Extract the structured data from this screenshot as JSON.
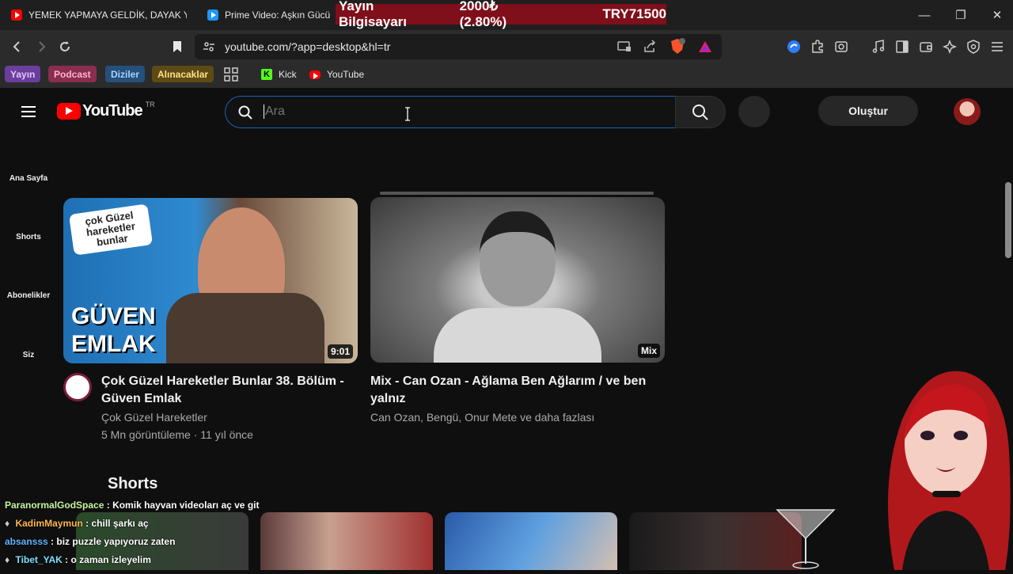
{
  "browser": {
    "tabs": [
      {
        "label": "YEMEK YAPMAYA GELDİK, DAYAK YE"
      },
      {
        "label": "Prime Video: Aşkın Gücü"
      }
    ],
    "overlay": {
      "title": "Yayın Bilgisayarı",
      "price": "2000₺ (2.80%)",
      "goal": "TRY71500"
    },
    "url": "youtube.com/?app=desktop&hl=tr",
    "bookmarks": {
      "chips": [
        "Yayın",
        "Podcast",
        "Diziler",
        "Alınacaklar"
      ],
      "links": [
        "Kick",
        "YouTube"
      ]
    }
  },
  "youtube": {
    "logo_text": "YouTube",
    "country": "TR",
    "search_placeholder": "Ara",
    "create_label": "Oluştur",
    "sidebar": [
      "Ana Sayfa",
      "Shorts",
      "Abonelikler",
      "Siz"
    ],
    "videos": [
      {
        "title": "Çok Güzel Hareketler Bunlar 38. Bölüm - Güven Emlak",
        "channel": "Çok Güzel Hareketler",
        "meta": "5 Mn görüntüleme · 11 yıl önce",
        "duration": "9:01",
        "thumb_text": "GÜVEN EMLAK",
        "thumb_logo": "çok Güzel hareketler bunlar"
      },
      {
        "title": "Mix - Can Ozan - Ağlama Ben Ağlarım / ve ben yalnız",
        "channel": "Can Ozan, Bengü, Onur Mete ve daha fazlası",
        "duration": "Mix"
      }
    ],
    "shorts_heading": "Shorts"
  },
  "chat": [
    {
      "user": "ParanormalGodSpace",
      "msg": ": Komik hayvan videoları aç ve git",
      "color": "#c8f7a0"
    },
    {
      "user": "KadimMaymun",
      "msg": ": chill şarkı aç",
      "color": "#ffb84d"
    },
    {
      "user": "absansss",
      "msg": ": biz puzzle yapıyoruz zaten",
      "color": "#5fb3ff"
    },
    {
      "user": "Tibet_YAK",
      "msg": ": o zaman izleyelim",
      "color": "#7fe0ff"
    }
  ]
}
